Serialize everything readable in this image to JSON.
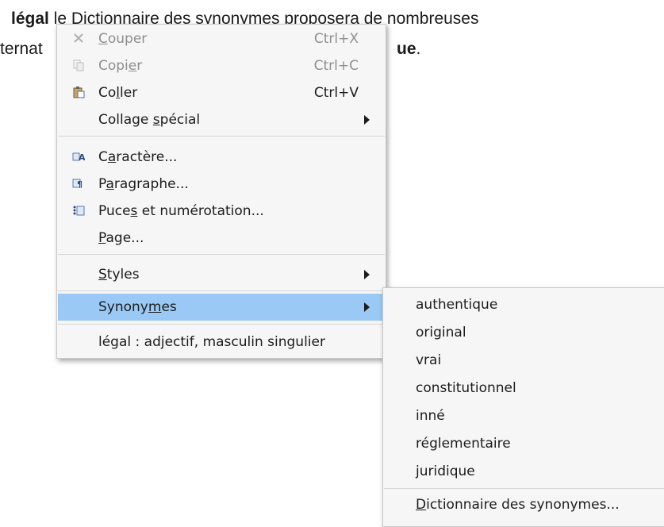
{
  "document": {
    "line1_bold": "légal",
    "line1_rest": " le Dictionnaire des synonymes proposera de nombreuses",
    "line2_start": "ternat",
    "line2_end_bold": "ue",
    "line2_end_rest": "."
  },
  "context_menu": {
    "items": [
      {
        "icon": "scissors-icon",
        "pre": "",
        "u": "C",
        "post": "ouper",
        "shortcut": "Ctrl+X",
        "disabled": true
      },
      {
        "icon": "copy-icon",
        "pre": "Copi",
        "u": "e",
        "post": "r",
        "shortcut": "Ctrl+C",
        "disabled": true
      },
      {
        "icon": "paste-icon",
        "pre": "Co",
        "u": "l",
        "post": "ler",
        "shortcut": "Ctrl+V",
        "disabled": false
      },
      {
        "icon": "",
        "pre": "Collage ",
        "u": "s",
        "post": "pécial",
        "submenu": true
      },
      {
        "icon": "character-icon",
        "pre": "C",
        "u": "a",
        "post": "ractère...",
        "disabled": false
      },
      {
        "icon": "paragraph-icon",
        "pre": "P",
        "u": "a",
        "post": "ragraphe...",
        "disabled": false
      },
      {
        "icon": "bullets-icon",
        "pre": "Puce",
        "u": "s",
        "post": " et numérotation...",
        "disabled": false
      },
      {
        "icon": "",
        "pre": "",
        "u": "P",
        "post": "age...",
        "disabled": false
      },
      {
        "icon": "",
        "pre": "",
        "u": "S",
        "post": "tyles",
        "submenu": true
      },
      {
        "icon": "",
        "pre": "Synony",
        "u": "m",
        "post": "es",
        "submenu": true,
        "highlighted": true
      },
      {
        "icon": "",
        "pre": "légal :  adjectif, masculin singulier",
        "u": "",
        "post": ""
      }
    ]
  },
  "synonym_submenu": {
    "items": [
      "authentique",
      "original",
      "vrai",
      "constitutionnel",
      "inné",
      "réglementaire",
      "juridique"
    ],
    "dictionary_pre": "",
    "dictionary_u": "D",
    "dictionary_post": "ictionnaire des synonymes..."
  },
  "colors": {
    "highlight": "#99c9f4",
    "menu_bg": "#f6f6f6",
    "disabled_text": "#8f8f8f"
  }
}
